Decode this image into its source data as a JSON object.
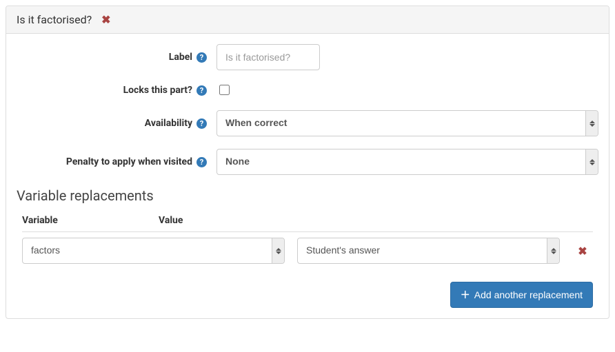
{
  "panel": {
    "title": "Is it factorised?"
  },
  "fields": {
    "label": {
      "label": "Label",
      "placeholder": "Is it factorised?",
      "value": ""
    },
    "locks": {
      "label": "Locks this part?",
      "checked": false
    },
    "availability": {
      "label": "Availability",
      "value": "When correct"
    },
    "penalty": {
      "label": "Penalty to apply when visited",
      "value": "None"
    }
  },
  "replacements": {
    "heading": "Variable replacements",
    "columns": {
      "variable": "Variable",
      "value": "Value"
    },
    "rows": [
      {
        "variable": "factors",
        "value": "Student's answer"
      }
    ]
  },
  "actions": {
    "add_replacement": "Add another replacement"
  }
}
